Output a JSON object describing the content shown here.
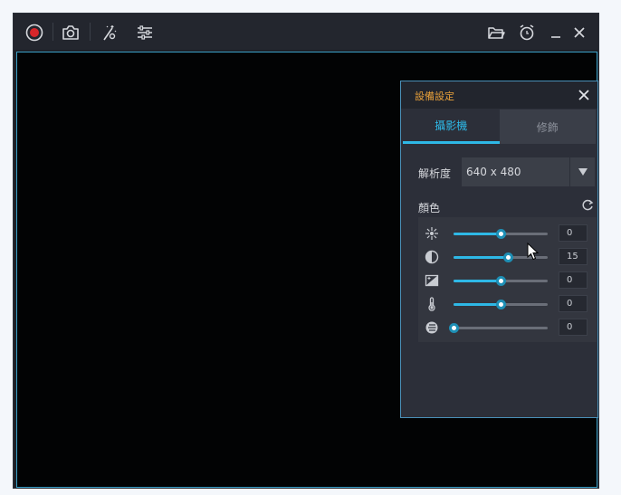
{
  "toolbar": {
    "icons": [
      "record-icon",
      "camera-icon",
      "effects-icon",
      "settings-sliders-icon",
      "folder-icon",
      "alarm-icon",
      "minimize-icon",
      "close-icon"
    ]
  },
  "panel": {
    "title": "設備設定",
    "tabs": [
      {
        "label": "攝影機",
        "active": true
      },
      {
        "label": "修飾",
        "active": false
      }
    ],
    "resolution": {
      "label": "解析度",
      "value": "640 x 480"
    },
    "color": {
      "label": "顏色",
      "adjustments": [
        {
          "name": "brightness",
          "icon": "brightness-icon",
          "value": "0",
          "level": 0.5
        },
        {
          "name": "contrast",
          "icon": "contrast-icon",
          "value": "15",
          "level": 0.575
        },
        {
          "name": "exposure",
          "icon": "exposure-icon",
          "value": "0",
          "level": 0.5
        },
        {
          "name": "temperature",
          "icon": "thermometer-icon",
          "value": "0",
          "level": 0.5
        },
        {
          "name": "saturation",
          "icon": "saturation-icon",
          "value": "0",
          "level": 0.0
        }
      ]
    }
  },
  "colors": {
    "accent": "#2eb8e6",
    "title_orange": "#e9a13a",
    "record_red": "#d8262a"
  }
}
